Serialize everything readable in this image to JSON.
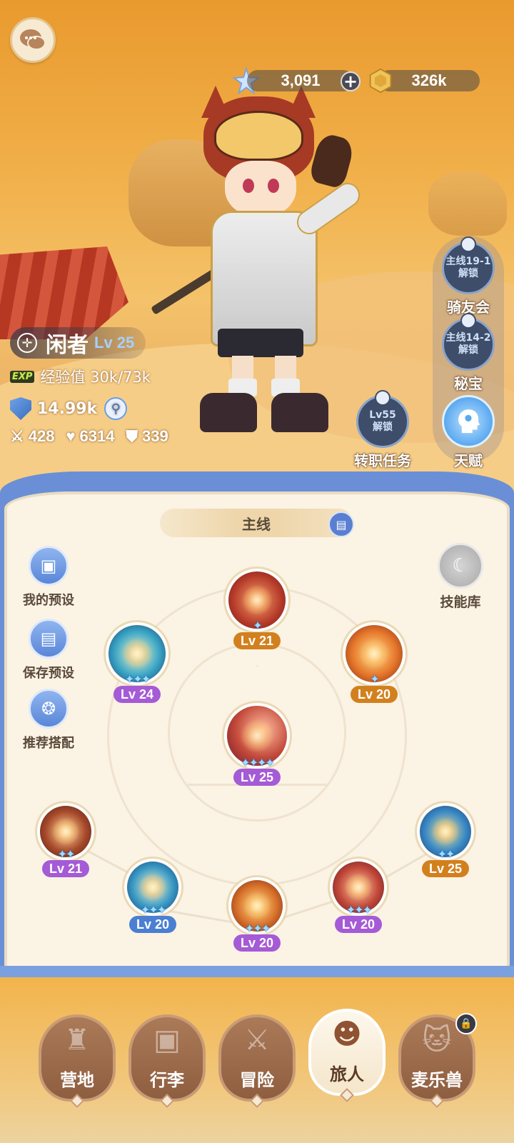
{
  "currency": {
    "gems": "3,091",
    "gold": "326k",
    "gems_icon": "crystal-star-icon",
    "gold_icon": "gold-coin-icon"
  },
  "side_menu": [
    {
      "lock_line1": "主线19-1",
      "lock_line2": "解锁",
      "label": "骑友会"
    },
    {
      "lock_line1": "主线14-2",
      "lock_line2": "解锁",
      "label": "秘宝"
    },
    {
      "label": "天赋"
    }
  ],
  "job_change": {
    "lock_line1": "Lv55",
    "lock_line2": "解锁",
    "label": "转职任务"
  },
  "player": {
    "name": "闲者",
    "level": "Lv 25",
    "exp_tag": "EXP",
    "exp_text": "经验值 30k/73k",
    "power": "14.99k",
    "attack": "428",
    "hp": "6314",
    "defense": "339"
  },
  "board": {
    "tab_label": "主线",
    "left_buttons": [
      "我的预设",
      "保存预设",
      "推荐搭配"
    ],
    "skill_library": "技能库",
    "skills": [
      {
        "id": "top",
        "level": "Lv 21",
        "stars": "✦",
        "badge": "orange"
      },
      {
        "id": "upper-left",
        "level": "Lv 24",
        "stars": "✦✦✦",
        "badge": "purple"
      },
      {
        "id": "upper-right",
        "level": "Lv 20",
        "stars": "✦",
        "badge": "orange"
      },
      {
        "id": "center",
        "level": "Lv 25",
        "stars": "✦✦✦✦",
        "badge": "purple"
      },
      {
        "id": "lower-left",
        "level": "Lv 21",
        "stars": "✦✦",
        "badge": "purple"
      },
      {
        "id": "lower-right",
        "level": "Lv 25",
        "stars": "✦✦",
        "badge": "orange"
      },
      {
        "id": "bottom-1",
        "level": "Lv 20",
        "stars": "✦✦✦",
        "badge": "blue"
      },
      {
        "id": "bottom-2",
        "level": "Lv 20",
        "stars": "✦✦✦",
        "badge": "purple"
      },
      {
        "id": "bottom-3",
        "level": "Lv 20",
        "stars": "✦✦✦",
        "badge": "purple"
      }
    ]
  },
  "bottom_nav": [
    {
      "label": "营地",
      "icon": "castle-icon"
    },
    {
      "label": "行李",
      "icon": "backpack-icon"
    },
    {
      "label": "冒险",
      "icon": "crossed-swords-icon"
    },
    {
      "label": "旅人",
      "icon": "traveler-icon",
      "active": true
    },
    {
      "label": "麦乐兽",
      "icon": "cat-icon"
    }
  ],
  "colors": {
    "board_frame": "#6a8fd6",
    "board_bg": "#fbf3e4",
    "lv_purple": "#a55ad6",
    "lv_orange": "#d2801e",
    "lv_blue": "#4a7fd2"
  }
}
